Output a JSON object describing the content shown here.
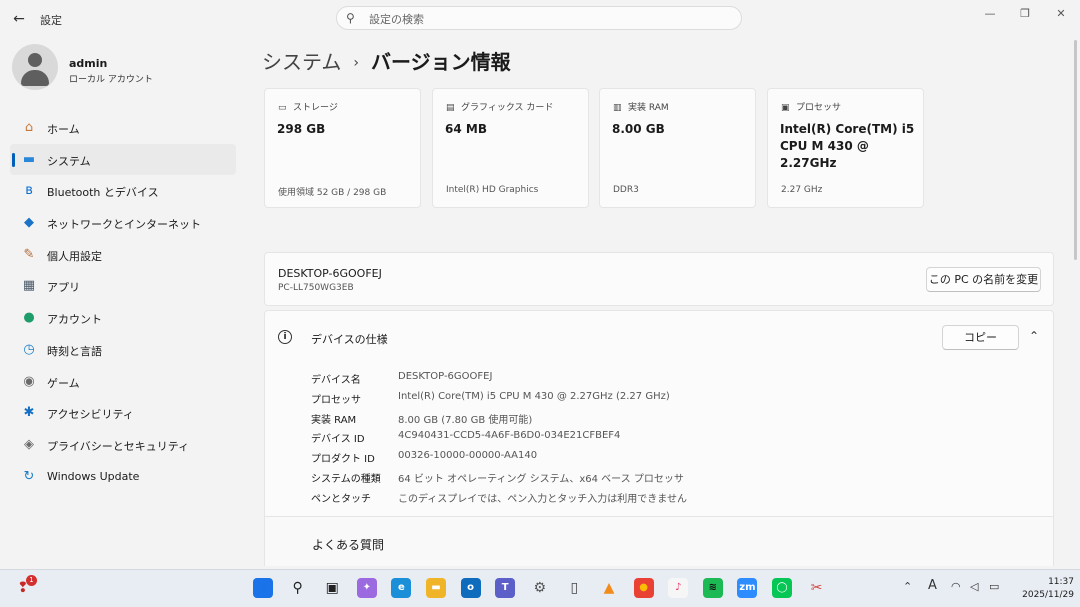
{
  "window": {
    "app_title": "設定",
    "search_placeholder": "設定の検索",
    "minimize": "—",
    "maximize": "❐",
    "close": "✕"
  },
  "user": {
    "name": "admin",
    "account_type": "ローカル アカウント"
  },
  "sidebar": {
    "items": [
      {
        "label": "ホーム",
        "icon": "home-icon",
        "color": "#c8783c",
        "glyph": "⌂"
      },
      {
        "label": "システム",
        "icon": "monitor-icon",
        "color": "#2b88d8",
        "glyph": "▬",
        "selected": true
      },
      {
        "label": "Bluetooth とデバイス",
        "icon": "bluetooth-icon",
        "color": "#0a6ed1",
        "glyph": "ʙ"
      },
      {
        "label": "ネットワークとインターネット",
        "icon": "wifi-icon",
        "color": "#1a73c7",
        "glyph": "◆"
      },
      {
        "label": "個人用設定",
        "icon": "paintbrush-icon",
        "color": "#b06a3a",
        "glyph": "✎"
      },
      {
        "label": "アプリ",
        "icon": "apps-icon",
        "color": "#4a5a6a",
        "glyph": "▦"
      },
      {
        "label": "アカウント",
        "icon": "person-icon",
        "color": "#1e9c6a",
        "glyph": "●"
      },
      {
        "label": "時刻と言語",
        "icon": "globe-clock-icon",
        "color": "#1a7fc7",
        "glyph": "◷"
      },
      {
        "label": "ゲーム",
        "icon": "gamepad-icon",
        "color": "#6b6b6b",
        "glyph": "◉"
      },
      {
        "label": "アクセシビリティ",
        "icon": "accessibility-icon",
        "color": "#1570c4",
        "glyph": "✱"
      },
      {
        "label": "プライバシーとセキュリティ",
        "icon": "shield-icon",
        "color": "#6b6b6b",
        "glyph": "◈"
      },
      {
        "label": "Windows Update",
        "icon": "windows-update-icon",
        "color": "#1a7fc7",
        "glyph": "↻"
      }
    ]
  },
  "breadcrumb": {
    "parent": "システム",
    "separator": "›",
    "current": "バージョン情報"
  },
  "cards": [
    {
      "title": "ストレージ",
      "icon": "storage-icon",
      "glyph": "▭",
      "value": "298 GB",
      "sub": "使用領域 52 GB / 298 GB"
    },
    {
      "title": "グラフィックス カード",
      "icon": "graphics-card-icon",
      "glyph": "▤",
      "value": "64 MB",
      "sub": "Intel(R) HD Graphics"
    },
    {
      "title": "実装 RAM",
      "icon": "ram-icon",
      "glyph": "▥",
      "value": "8.00 GB",
      "sub": "DDR3"
    },
    {
      "title": "プロセッサ",
      "icon": "processor-icon",
      "glyph": "▣",
      "value": "Intel(R) Core(TM) i5 CPU       M 430  @ 2.27GHz",
      "sub": "2.27 GHz"
    }
  ],
  "device": {
    "name": "DESKTOP-6GOOFEJ",
    "model": "PC-LL750WG3EB",
    "rename_label": "この PC の名前を変更"
  },
  "specs": {
    "title": "デバイスの仕様",
    "copy_label": "コピー",
    "rows": [
      {
        "key": "デバイス名",
        "value": "DESKTOP-6GOOFEJ"
      },
      {
        "key": "プロセッサ",
        "value": "Intel(R) Core(TM) i5 CPU       M 430  @ 2.27GHz (2.27 GHz)"
      },
      {
        "key": "実装 RAM",
        "value": "8.00 GB (7.80 GB 使用可能)"
      },
      {
        "key": "デバイス ID",
        "value": "4C940431-CCD5-4A6F-B6D0-034E21CFBEF4"
      },
      {
        "key": "プロダクト ID",
        "value": "00326-10000-00000-AA140"
      },
      {
        "key": "システムの種類",
        "value": "64 ビット オペレーティング システム、x64 ベース プロセッサ"
      },
      {
        "key": "ペンとタッチ",
        "value": "このディスプレイでは、ペン入力とタッチ入力は利用できません"
      }
    ]
  },
  "faq": {
    "title": "よくある質問"
  },
  "taskbar": {
    "notification_badge": "1",
    "apps": [
      {
        "name": "start-button",
        "glyph": "⊞",
        "color": "#1a73e8",
        "fg": "#1a73e8"
      },
      {
        "name": "search-button",
        "glyph": "⚲",
        "color": "transparent",
        "fg": "#222"
      },
      {
        "name": "task-view-button",
        "glyph": "▣",
        "color": "transparent",
        "fg": "#222"
      },
      {
        "name": "copilot-icon",
        "glyph": "✦",
        "color": "#9b6ae0",
        "fg": "#fff"
      },
      {
        "name": "edge-icon",
        "glyph": "e",
        "color": "#1b8fd8",
        "fg": "#fff"
      },
      {
        "name": "file-explorer-icon",
        "glyph": "▬",
        "color": "#f0b429",
        "fg": "#fff"
      },
      {
        "name": "outlook-icon",
        "glyph": "o",
        "color": "#0f6cbd",
        "fg": "#fff"
      },
      {
        "name": "teams-icon",
        "glyph": "T",
        "color": "#5b5fc7",
        "fg": "#fff"
      },
      {
        "name": "settings-icon",
        "glyph": "⚙",
        "color": "transparent",
        "fg": "#555"
      },
      {
        "name": "notepad-icon",
        "glyph": "▯",
        "color": "transparent",
        "fg": "#444"
      },
      {
        "name": "vlc-icon",
        "glyph": "▲",
        "color": "transparent",
        "fg": "#f28a1c"
      },
      {
        "name": "chrome-icon",
        "glyph": "●",
        "color": "#e94235",
        "fg": "#fbbc04"
      },
      {
        "name": "itunes-icon",
        "glyph": "♪",
        "color": "#f6f6f6",
        "fg": "#e03a6a"
      },
      {
        "name": "spotify-icon",
        "glyph": "≋",
        "color": "#1db954",
        "fg": "#111"
      },
      {
        "name": "zoom-icon",
        "glyph": "zm",
        "color": "#2d8cff",
        "fg": "#fff"
      },
      {
        "name": "line-icon",
        "glyph": "◯",
        "color": "#06c755",
        "fg": "#fff"
      },
      {
        "name": "snipping-tool-icon",
        "glyph": "✂",
        "color": "transparent",
        "fg": "#d6453d"
      }
    ],
    "time": "11:37",
    "date": "2025/11/29",
    "ime": "A"
  }
}
